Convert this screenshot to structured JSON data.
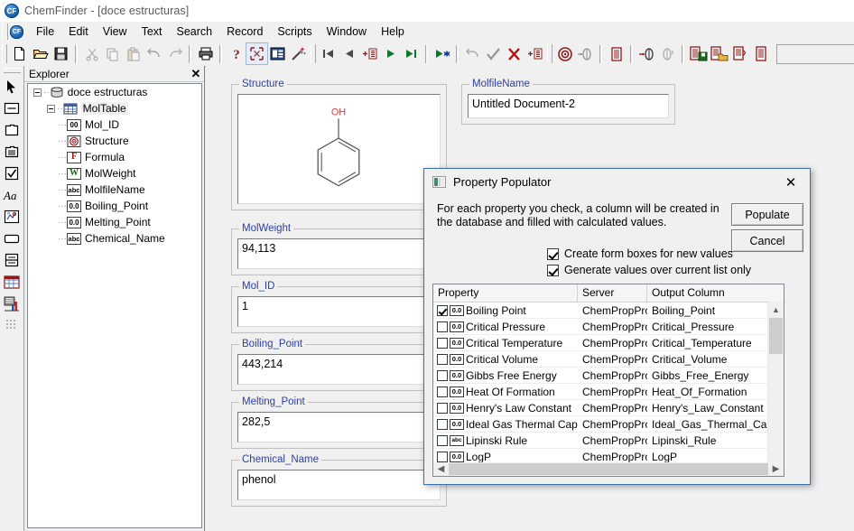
{
  "window": {
    "app_icon": "chemfinder-icon",
    "title": "ChemFinder - [doce estructuras]"
  },
  "menubar": {
    "doc_icon": "document-icon",
    "items": [
      {
        "label": "File"
      },
      {
        "label": "Edit"
      },
      {
        "label": "View"
      },
      {
        "label": "Text"
      },
      {
        "label": "Search"
      },
      {
        "label": "Record"
      },
      {
        "label": "Scripts"
      },
      {
        "label": "Window"
      },
      {
        "label": "Help"
      }
    ]
  },
  "toolbar": {
    "groups": [
      [
        "new-file-icon",
        "open-folder-icon",
        "save-disk-icon"
      ],
      [
        "cut-scissors-icon",
        "copy-icon",
        "paste-icon",
        "undo-icon",
        "redo-icon"
      ],
      [
        "print-icon"
      ],
      [
        "help-question-icon",
        "fit-structure-icon",
        "form-view-icon",
        "magic-wand-icon"
      ],
      [
        "first-record-icon",
        "previous-record-icon",
        "add-record-icon",
        "next-record-icon",
        "last-record-icon"
      ],
      [
        "play-all-icon"
      ],
      [
        "undo-search-icon",
        "accept-check-icon",
        "cancel-x-icon",
        "insert-record-icon"
      ],
      [
        "search-target-icon",
        "substructure-search-icon"
      ],
      [
        "list-view-icon"
      ],
      [
        "retrieve-all-icon",
        "refine-search-icon"
      ],
      [
        "save-list-icon",
        "open-list-icon",
        "export-list-icon",
        "show-list-icon"
      ]
    ]
  },
  "palette": {
    "tools": [
      {
        "icon": "arrow-pointer-icon",
        "name": "select-tool"
      },
      {
        "icon": "text-box-icon",
        "name": "textbox-tool"
      },
      {
        "icon": "picture-box-icon",
        "name": "picturebox-tool"
      },
      {
        "icon": "list-box-icon",
        "name": "listbox-tool"
      },
      {
        "icon": "check-box-icon",
        "name": "checkbox-tool"
      },
      {
        "icon": "font-icon",
        "name": "font-tool"
      },
      {
        "icon": "structure-box-icon",
        "name": "structurebox-tool"
      },
      {
        "icon": "button-icon",
        "name": "button-tool"
      },
      {
        "icon": "split-pane-icon",
        "name": "splitpane-tool"
      },
      {
        "icon": "table-grid-icon",
        "name": "table-tool"
      },
      {
        "icon": "chart-icon",
        "name": "chart-tool"
      },
      {
        "icon": "grid-dots-icon",
        "name": "grid-tool"
      }
    ]
  },
  "explorer": {
    "title": "Explorer",
    "close_icon": "close-icon",
    "tree": [
      {
        "label": "doce estructuras",
        "icon": "database-icon",
        "level": 0,
        "expander": true,
        "selected": false
      },
      {
        "label": "MolTable",
        "icon": "table-icon",
        "level": 1,
        "expander": true,
        "selected": true
      },
      {
        "label": "Mol_ID",
        "icon": "integer-icon",
        "icon_text": "00",
        "level": 2,
        "expander": false,
        "selected": false
      },
      {
        "label": "Structure",
        "icon": "structure-icon",
        "level": 2,
        "expander": false,
        "selected": false
      },
      {
        "label": "Formula",
        "icon": "formula-icon",
        "icon_text": "F",
        "level": 2,
        "expander": false,
        "selected": false
      },
      {
        "label": "MolWeight",
        "icon": "molweight-icon",
        "icon_text": "W",
        "level": 2,
        "expander": false,
        "selected": false
      },
      {
        "label": "MolfileName",
        "icon": "text-icon",
        "icon_text": "abc",
        "level": 2,
        "expander": false,
        "selected": false
      },
      {
        "label": "Boiling_Point",
        "icon": "number-icon",
        "icon_text": "0.0",
        "level": 2,
        "expander": false,
        "selected": false
      },
      {
        "label": "Melting_Point",
        "icon": "number-icon",
        "icon_text": "0.0",
        "level": 2,
        "expander": false,
        "selected": false
      },
      {
        "label": "Chemical_Name",
        "icon": "text-icon",
        "icon_text": "abc",
        "level": 2,
        "expander": false,
        "selected": false
      }
    ]
  },
  "form": {
    "fields": [
      {
        "legend": "Structure",
        "value": "",
        "type": "structure"
      },
      {
        "legend": "MolfileName",
        "value": "Untitled Document-2",
        "type": "text"
      },
      {
        "legend": "MolWeight",
        "value": "94,113",
        "type": "text"
      },
      {
        "legend": "Mol_ID",
        "value": "1",
        "type": "text"
      },
      {
        "legend": "Boiling_Point",
        "value": "443,214",
        "type": "text"
      },
      {
        "legend": "Melting_Point",
        "value": "282,5",
        "type": "text"
      },
      {
        "legend": "Chemical_Name",
        "value": "phenol",
        "type": "text"
      }
    ],
    "structure": {
      "label": "OH",
      "label_color": "#d04040",
      "bond_color": "#555555",
      "molecule": "phenol"
    }
  },
  "dialog": {
    "icon": "property-populator-icon",
    "title": "Property Populator",
    "close_icon": "close-icon",
    "description": "For each property you check, a column will be created in the database and filled with calculated values.",
    "buttons": {
      "populate": "Populate",
      "cancel": "Cancel"
    },
    "options": [
      {
        "label": "Create form boxes for new values",
        "checked": true
      },
      {
        "label": "Generate values over current list only",
        "checked": true
      }
    ],
    "table": {
      "columns": [
        "Property",
        "Server",
        "Output Column"
      ],
      "rows": [
        {
          "checked": true,
          "type_icon": "0.0",
          "property": "Boiling Point",
          "server": "ChemPropPro",
          "output": "Boiling_Point"
        },
        {
          "checked": false,
          "type_icon": "0.0",
          "property": "Critical Pressure",
          "server": "ChemPropPro",
          "output": "Critical_Pressure"
        },
        {
          "checked": false,
          "type_icon": "0.0",
          "property": "Critical Temperature",
          "server": "ChemPropPro",
          "output": "Critical_Temperature"
        },
        {
          "checked": false,
          "type_icon": "0.0",
          "property": "Critical Volume",
          "server": "ChemPropPro",
          "output": "Critical_Volume"
        },
        {
          "checked": false,
          "type_icon": "0.0",
          "property": "Gibbs Free Energy",
          "server": "ChemPropPro",
          "output": "Gibbs_Free_Energy"
        },
        {
          "checked": false,
          "type_icon": "0.0",
          "property": "Heat Of Formation",
          "server": "ChemPropPro",
          "output": "Heat_Of_Formation"
        },
        {
          "checked": false,
          "type_icon": "0.0",
          "property": "Henry's Law Constant",
          "server": "ChemPropPro",
          "output": "Henry's_Law_Constant"
        },
        {
          "checked": false,
          "type_icon": "0.0",
          "property": "Ideal Gas Thermal Cap...",
          "server": "ChemPropPro",
          "output": "Ideal_Gas_Thermal_Capacity"
        },
        {
          "checked": false,
          "type_icon": "abc",
          "property": "Lipinski Rule",
          "server": "ChemPropPro",
          "output": "Lipinski_Rule"
        },
        {
          "checked": false,
          "type_icon": "0.0",
          "property": "LogP",
          "server": "ChemPropPro",
          "output": "LogP"
        }
      ],
      "scroll_up_icon": "chevron-up-icon",
      "scroll_down_icon": "chevron-down-icon",
      "scroll_left_icon": "chevron-left-icon",
      "scroll_right_icon": "chevron-right-icon"
    }
  },
  "colors": {
    "legend_blue": "#2b3ea8",
    "toolbar_red": "#8b1a1a",
    "dialog_border": "#3c6ea8",
    "face": "#f0f0f0"
  }
}
